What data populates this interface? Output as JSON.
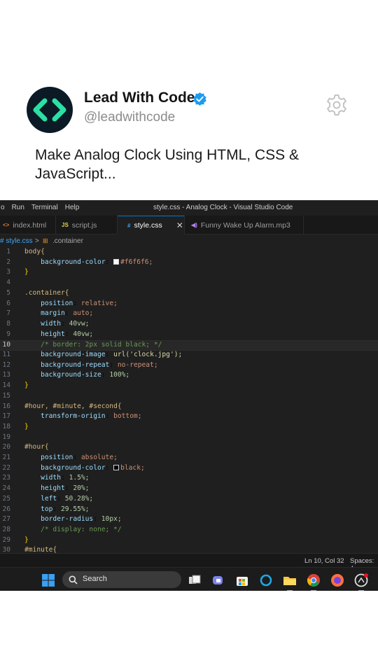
{
  "post": {
    "display_name": "Lead With Code",
    "handle": "@leadwithcode",
    "text_line1": "Make Analog Clock Using HTML, CSS &",
    "text_line2": "JavaScript..."
  },
  "vscode": {
    "menu": [
      "o",
      "Run",
      "Terminal",
      "Help"
    ],
    "window_title": "style.css - Analog Clock - Visual Studio Code",
    "tabs": [
      {
        "icon": "<>",
        "label": "index.html"
      },
      {
        "icon": "JS",
        "label": "script.js"
      },
      {
        "icon": "#",
        "label": "style.css",
        "close": "✕"
      },
      {
        "icon": "◀)",
        "label": "Funny Wake Up Alarm.mp3"
      }
    ],
    "breadcrumb": {
      "file": "# style.css",
      "sep": ">",
      "symbol": ".container"
    },
    "code": [
      {
        "n": "1",
        "t": "body{"
      },
      {
        "n": "2",
        "p": "background-color",
        "v": "#f6f6f6;"
      },
      {
        "n": "3",
        "t": "}"
      },
      {
        "n": "4",
        "t": ""
      },
      {
        "n": "5",
        "t": ".container{"
      },
      {
        "n": "6",
        "p": "position",
        "v": "relative;"
      },
      {
        "n": "7",
        "p": "margin",
        "v": "auto;"
      },
      {
        "n": "8",
        "p": "width",
        "v": "40vw;"
      },
      {
        "n": "9",
        "p": "height",
        "v": "40vw;"
      },
      {
        "n": "10",
        "c": "/* border: 2px solid black; */"
      },
      {
        "n": "11",
        "p": "background-image",
        "v": "url('clock.jpg');"
      },
      {
        "n": "12",
        "p": "background-repeat",
        "v": "no-repeat;"
      },
      {
        "n": "13",
        "p": "background-size",
        "v": "100%;"
      },
      {
        "n": "14",
        "t": "}"
      },
      {
        "n": "15",
        "t": ""
      },
      {
        "n": "16",
        "t": "#hour, #minute, #second{"
      },
      {
        "n": "17",
        "p": "transform-origin",
        "v": "bottom;"
      },
      {
        "n": "18",
        "t": "}"
      },
      {
        "n": "19",
        "t": ""
      },
      {
        "n": "20",
        "t": "#hour{"
      },
      {
        "n": "21",
        "p": "position",
        "v": "absolute;"
      },
      {
        "n": "22",
        "p": "background-color",
        "v": "black;"
      },
      {
        "n": "23",
        "p": "width",
        "v": "1.5%;"
      },
      {
        "n": "24",
        "p": "height",
        "v": "20%;"
      },
      {
        "n": "25",
        "p": "left",
        "v": "50.28%;"
      },
      {
        "n": "26",
        "p": "top",
        "v": "29.55%;"
      },
      {
        "n": "27",
        "p": "border-radius",
        "v": "10px;"
      },
      {
        "n": "28",
        "c": "/* display: none; */"
      },
      {
        "n": "29",
        "t": "}"
      },
      {
        "n": "30",
        "t": "#minute{"
      }
    ],
    "status": {
      "cursor": "Ln 10, Col 32",
      "spaces": "Spaces: 4"
    },
    "taskbar": {
      "search_label": "Search"
    },
    "colors": {
      "accent": "#1d9bf0",
      "logo_green": "#2be0a4",
      "editor_bg": "#1f1f1f"
    }
  }
}
